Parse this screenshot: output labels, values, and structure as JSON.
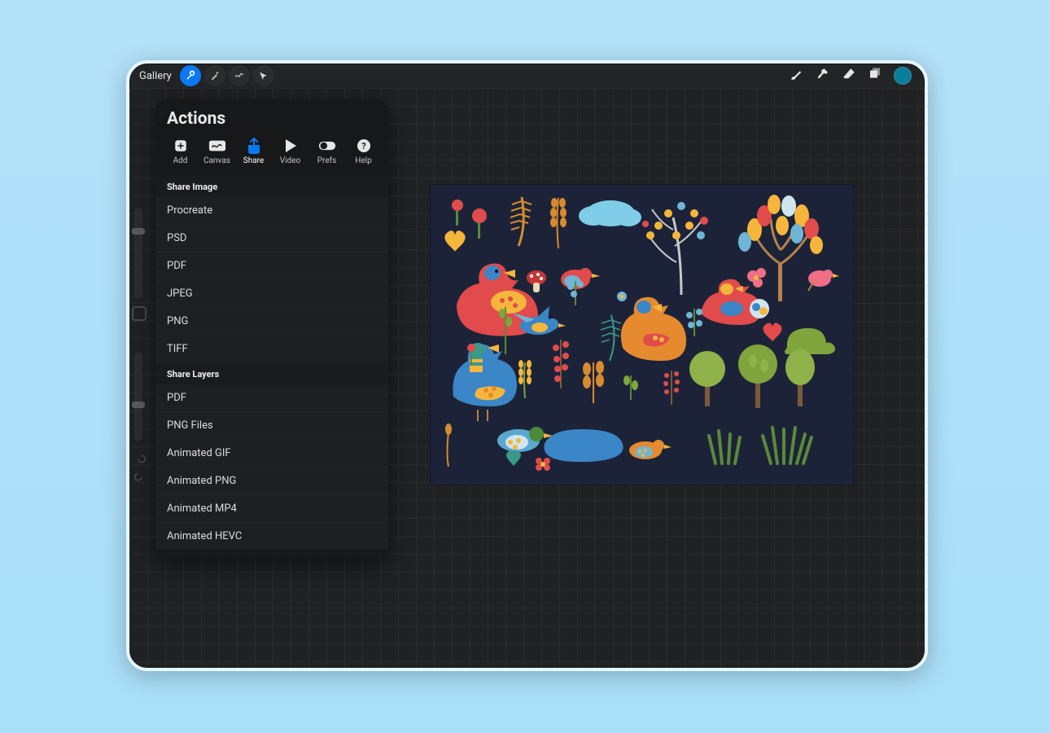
{
  "topbar": {
    "gallery": "Gallery"
  },
  "popover": {
    "title": "Actions",
    "tabs": [
      {
        "label": "Add",
        "icon": "add"
      },
      {
        "label": "Canvas",
        "icon": "canvas"
      },
      {
        "label": "Share",
        "icon": "share",
        "active": true
      },
      {
        "label": "Video",
        "icon": "video"
      },
      {
        "label": "Prefs",
        "icon": "prefs"
      },
      {
        "label": "Help",
        "icon": "help"
      }
    ],
    "sections": [
      {
        "header": "Share Image",
        "items": [
          "Procreate",
          "PSD",
          "PDF",
          "JPEG",
          "PNG",
          "TIFF"
        ]
      },
      {
        "header": "Share Layers",
        "items": [
          "PDF",
          "PNG Files",
          "Animated GIF",
          "Animated PNG",
          "Animated MP4",
          "Animated HEVC"
        ]
      }
    ]
  },
  "colors": {
    "accent": "#0b79f5",
    "swatch": "#0a7e9a"
  }
}
